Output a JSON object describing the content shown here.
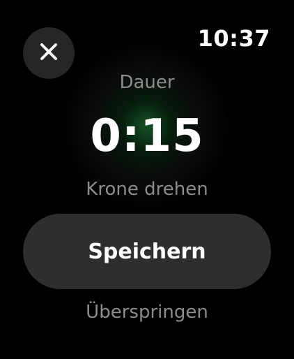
{
  "status_bar": {
    "time": "10:37"
  },
  "header": {
    "close_icon": "close-icon"
  },
  "duration": {
    "label": "Dauer",
    "value": "0:15",
    "hint": "Krone drehen"
  },
  "actions": {
    "save_label": "Speichern",
    "skip_label": "Überspringen"
  },
  "colors": {
    "background": "#000000",
    "button_bg": "#2e2e2e",
    "close_bg": "#262626",
    "secondary_text": "#8c8c8c",
    "accent_glow": "#2a9646"
  }
}
